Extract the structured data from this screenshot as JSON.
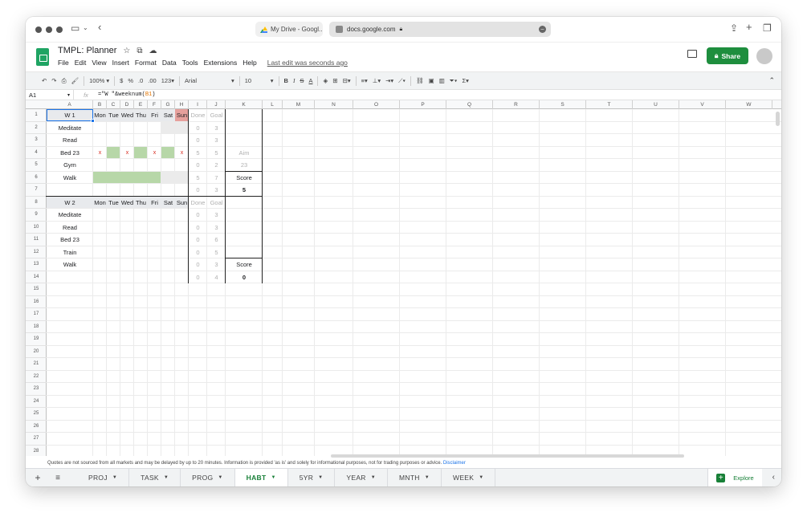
{
  "browser": {
    "tab_title": "My Drive - Googl...",
    "address": "docs.google.com"
  },
  "doc": {
    "title": "TMPL: Planner",
    "menus": [
      "File",
      "Edit",
      "View",
      "Insert",
      "Format",
      "Data",
      "Tools",
      "Extensions",
      "Help"
    ],
    "last_edit": "Last edit was seconds ago",
    "share_label": "Share"
  },
  "toolbar": {
    "zoom": "100%",
    "currency": "$",
    "percent": "%",
    "dec_less": ".0",
    "dec_more": ".00",
    "format_123": "123",
    "font": "Arial",
    "font_size": "10"
  },
  "formula_bar": {
    "cell_ref": "A1",
    "formula_pre": "=\"W \"&weeknum(",
    "formula_ref": "B1",
    "formula_post": ")"
  },
  "columns": [
    "A",
    "B",
    "C",
    "D",
    "E",
    "F",
    "G",
    "H",
    "I",
    "J",
    "K",
    "L",
    "M",
    "N",
    "O",
    "P",
    "Q",
    "R",
    "S",
    "T",
    "U",
    "V",
    "W"
  ],
  "rows": [
    "1",
    "2",
    "3",
    "4",
    "5",
    "6",
    "7",
    "8",
    "9",
    "10",
    "11",
    "12",
    "13",
    "14",
    "15",
    "16",
    "17",
    "18",
    "19",
    "20",
    "21",
    "22",
    "23",
    "24",
    "25",
    "26",
    "27",
    "28"
  ],
  "week1": {
    "label": "W 1",
    "days": [
      "Mon",
      "Tue",
      "Wed",
      "Thu",
      "Fri",
      "Sat",
      "Sun"
    ],
    "done_hdr": "Done",
    "goal_hdr": "Goal",
    "habits": [
      "Meditate",
      "Read",
      "Bed 23",
      "Gym",
      "Walk"
    ],
    "done": [
      "0",
      "0",
      "5",
      "0",
      "5",
      "0"
    ],
    "goal": [
      "3",
      "3",
      "5",
      "2",
      "7",
      "3"
    ],
    "x_marks": [
      "x",
      "x",
      "x",
      "x"
    ],
    "aim_label": "Aim",
    "aim_value": "23",
    "score_label": "Score",
    "score_value": "5"
  },
  "week2": {
    "label": "W 2",
    "days": [
      "Mon",
      "Tue",
      "Wed",
      "Thu",
      "Fri",
      "Sat",
      "Sun"
    ],
    "done_hdr": "Done",
    "goal_hdr": "Goal",
    "habits": [
      "Meditate",
      "Read",
      "Bed 23",
      "Train",
      "Walk"
    ],
    "done": [
      "0",
      "0",
      "0",
      "0",
      "0",
      "0"
    ],
    "goal": [
      "3",
      "3",
      "6",
      "5",
      "3",
      "4"
    ],
    "score_label": "Score",
    "score_value": "0"
  },
  "footer": {
    "disclaimer": "Quotes are not sourced from all markets and may be delayed by up to 20 minutes. Information is provided 'as is' and solely for informational purposes, not for trading purposes or advice.",
    "disclaimer_link": "Disclaimer",
    "sheets": [
      "PROJ",
      "TASK",
      "PROG",
      "HABT",
      "5YR",
      "YEAR",
      "MNTH",
      "WEEK"
    ],
    "active_sheet": "HABT",
    "explore": "Explore"
  },
  "colors": {
    "share_green": "#1e8e3e",
    "done_fill": "#b7d7a8",
    "sunday_fill": "#e6a09c",
    "empty_fill": "#ebebeb"
  }
}
